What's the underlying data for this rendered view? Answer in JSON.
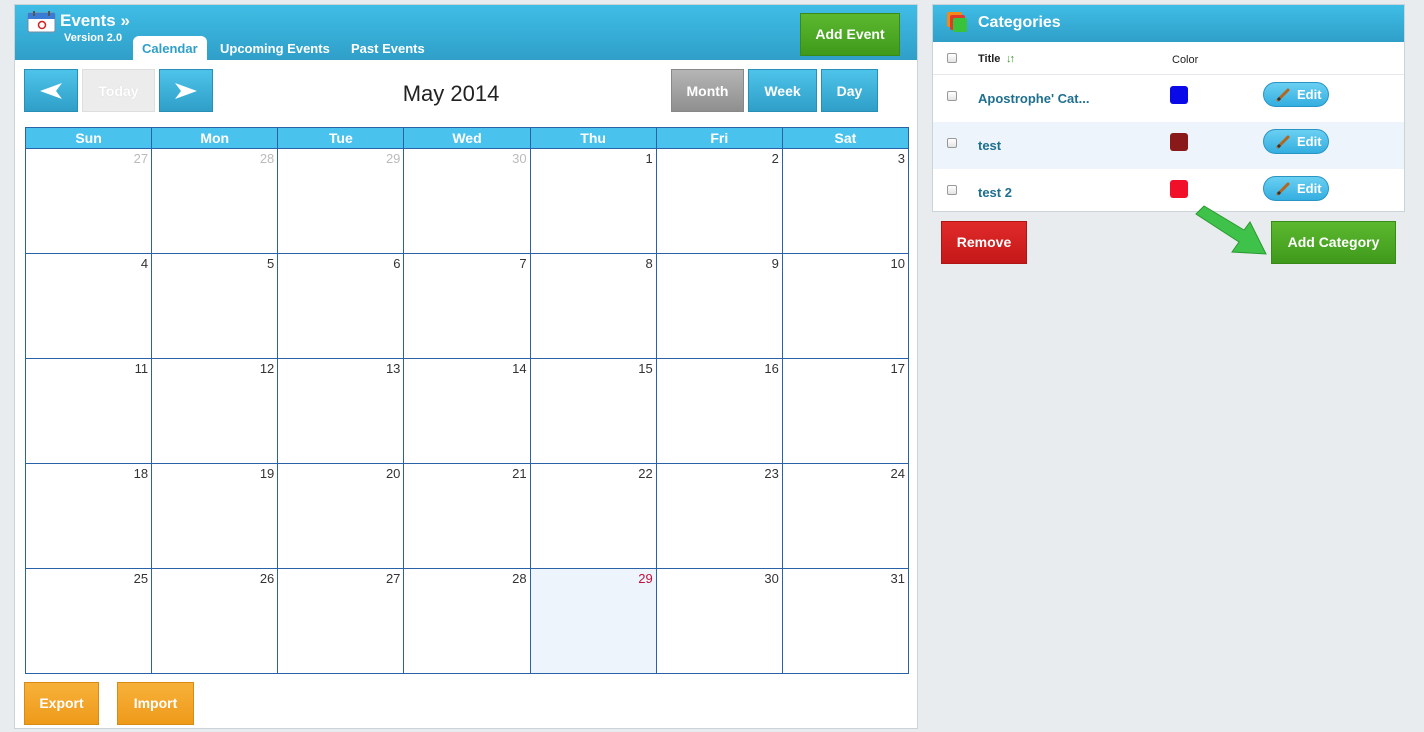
{
  "app": {
    "title": "Events »",
    "version": "Version 2.0"
  },
  "tabs": [
    {
      "label": "Calendar",
      "active": true
    },
    {
      "label": "Upcoming Events",
      "active": false
    },
    {
      "label": "Past Events",
      "active": false
    }
  ],
  "toolbar": {
    "add_event": "Add Event",
    "today": "Today",
    "prev_icon": "arrow-left-icon",
    "next_icon": "arrow-right-icon"
  },
  "calendar": {
    "month_label": "May 2014",
    "view_buttons": {
      "month": "Month",
      "week": "Week",
      "day": "Day",
      "active": "Month"
    },
    "days_of_week": [
      "Sun",
      "Mon",
      "Tue",
      "Wed",
      "Thu",
      "Fri",
      "Sat"
    ],
    "weeks": [
      [
        {
          "d": "27",
          "other": true
        },
        {
          "d": "28",
          "other": true
        },
        {
          "d": "29",
          "other": true
        },
        {
          "d": "30",
          "other": true
        },
        {
          "d": "1"
        },
        {
          "d": "2"
        },
        {
          "d": "3"
        }
      ],
      [
        {
          "d": "4"
        },
        {
          "d": "5"
        },
        {
          "d": "6"
        },
        {
          "d": "7"
        },
        {
          "d": "8"
        },
        {
          "d": "9"
        },
        {
          "d": "10"
        }
      ],
      [
        {
          "d": "11"
        },
        {
          "d": "12"
        },
        {
          "d": "13"
        },
        {
          "d": "14"
        },
        {
          "d": "15"
        },
        {
          "d": "16"
        },
        {
          "d": "17"
        }
      ],
      [
        {
          "d": "18"
        },
        {
          "d": "19"
        },
        {
          "d": "20"
        },
        {
          "d": "21"
        },
        {
          "d": "22"
        },
        {
          "d": "23"
        },
        {
          "d": "24"
        }
      ],
      [
        {
          "d": "25"
        },
        {
          "d": "26"
        },
        {
          "d": "27"
        },
        {
          "d": "28"
        },
        {
          "d": "29",
          "today": true
        },
        {
          "d": "30"
        },
        {
          "d": "31"
        }
      ]
    ]
  },
  "footer": {
    "export": "Export",
    "import": "Import"
  },
  "categories": {
    "title": "Categories",
    "columns": {
      "title": "Title",
      "color": "Color"
    },
    "rows": [
      {
        "name": "Apostrophe' Cat...",
        "color": "#0a0ae8",
        "edit": "Edit"
      },
      {
        "name": "test",
        "color": "#8a1a1a",
        "edit": "Edit"
      },
      {
        "name": "test 2",
        "color": "#f0102a",
        "edit": "Edit"
      }
    ],
    "remove": "Remove",
    "add": "Add Category"
  },
  "colors": {
    "header_blue": "#2f9fc8",
    "accent_green": "#3f9a1c",
    "danger_red": "#c51818",
    "orange": "#ee9a1a"
  }
}
